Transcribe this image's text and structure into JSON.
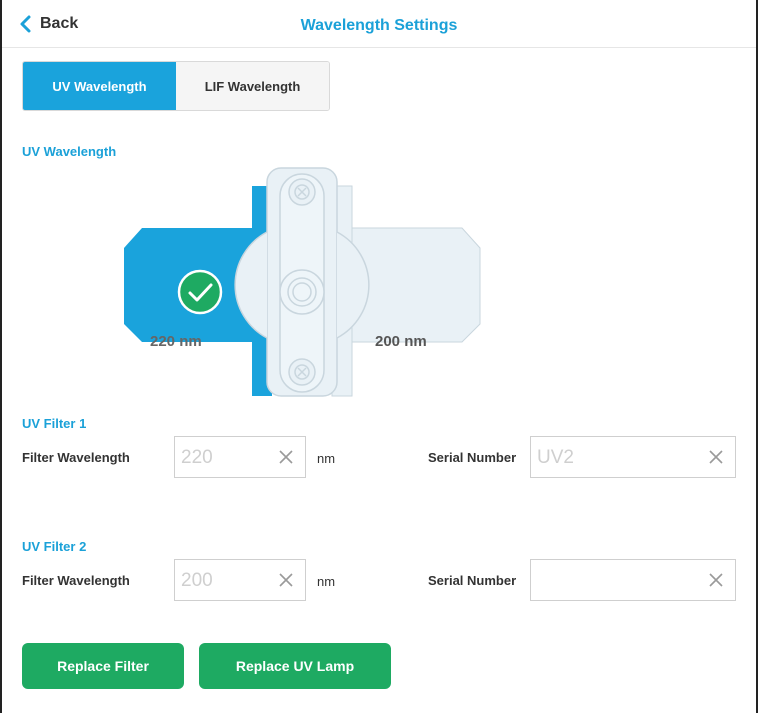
{
  "header": {
    "back_label": "Back",
    "title": "Wavelength Settings"
  },
  "tabs": [
    {
      "label": "UV Wavelength",
      "active": true
    },
    {
      "label": "LIF Wavelength",
      "active": false
    }
  ],
  "uv_section": {
    "label": "UV Wavelength",
    "wheel": {
      "left_label": "220 nm",
      "right_label": "200 nm",
      "selected": "220 nm"
    }
  },
  "filters": [
    {
      "title": "UV Filter 1",
      "wavelength_label": "Filter Wavelength",
      "wavelength_value": "220",
      "unit": "nm",
      "serial_label": "Serial Number",
      "serial_value": "UV2"
    },
    {
      "title": "UV Filter 2",
      "wavelength_label": "Filter Wavelength",
      "wavelength_value": "200",
      "unit": "nm",
      "serial_label": "Serial Number",
      "serial_value": ""
    }
  ],
  "actions": {
    "replace_filter": "Replace Filter",
    "replace_lamp": "Replace UV Lamp"
  },
  "colors": {
    "accent": "#1aa3dc",
    "success": "#1eaa62",
    "panel": "#e9f1f6"
  }
}
